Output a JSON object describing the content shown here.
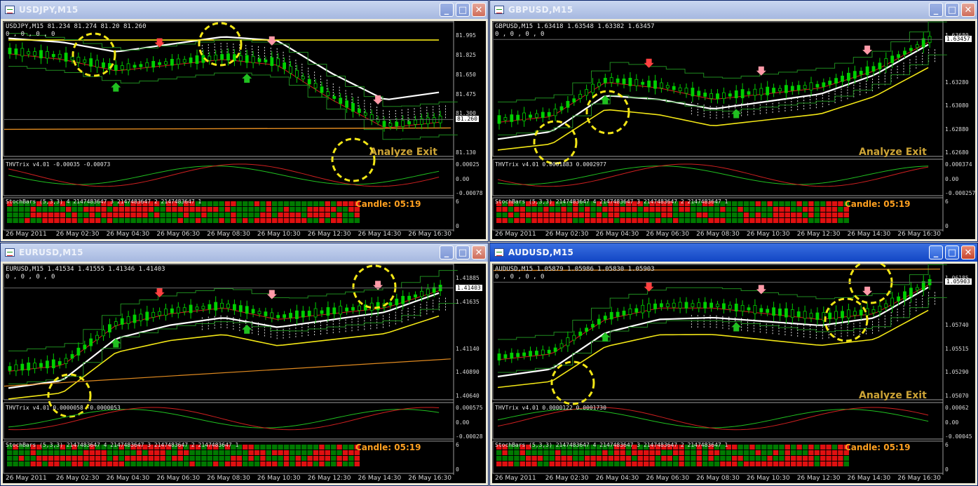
{
  "windows": [
    {
      "title": "USDJPY,M15",
      "active": false,
      "symbol_line": "USDJPY,M15  81.234 81.274 81.20 81.260",
      "zeros": "0 , 0 , 0 , 0",
      "price_labels": [
        "81.995",
        "81.825",
        "81.650",
        "81.475",
        "81.300",
        "81.260",
        "81.130"
      ],
      "current_price": "81.260",
      "trix_label": "THVTrix v4.01 -0.00035 -0.00073",
      "trix_labels": [
        "0.00025",
        "0.00",
        "-0.00078"
      ],
      "stoch_label": "StochBars (5,3,3) 4 2147483647 3 2147483647 2 2147483647 1",
      "stoch_labels": [
        "6",
        "0"
      ],
      "candle": "Candle:  05:19",
      "analyze": "Analyze Exit",
      "time_labels": [
        "26 May 2011",
        "26 May 02:30",
        "26 May 04:30",
        "26 May 06:30",
        "26 May 08:30",
        "26 May 10:30",
        "26 May 12:30",
        "26 May 14:30",
        "26 May 16:30"
      ]
    },
    {
      "title": "GBPUSD,M15",
      "active": false,
      "symbol_line": "GBPUSD,M15  1.63418 1.63548 1.63382 1.63457",
      "zeros": "0 , 0 , 0 , 0",
      "price_labels": [
        "1.63680",
        "1.63457",
        "1.63280",
        "1.63080",
        "1.62880",
        "1.62680"
      ],
      "current_price": "1.63457",
      "trix_label": "THVTrix v4.01 0.0001883 0.0002977",
      "trix_labels": [
        "0.000374",
        "0.00",
        "-0.000257"
      ],
      "stoch_label": "StochBars (5,3,3) 2147483647 4 2147483647 3 2147483647 2 2147483647 1",
      "stoch_labels": [
        "6",
        "0"
      ],
      "candle": "Candle:  05:19",
      "analyze": "Analyze Exit",
      "time_labels": [
        "26 May 2011",
        "26 May 02:30",
        "26 May 04:30",
        "26 May 06:30",
        "26 May 08:30",
        "26 May 10:30",
        "26 May 12:30",
        "26 May 14:30",
        "26 May 16:30"
      ]
    },
    {
      "title": "EURUSD,M15",
      "active": false,
      "symbol_line": "EURUSD,M15  1.41534 1.41555 1.41346 1.41403",
      "zeros": "0 , 0 , 0 , 0",
      "price_labels": [
        "1.41885",
        "1.41635",
        "1.41403",
        "1.41140",
        "1.40890",
        "1.40640"
      ],
      "current_price": "1.41403",
      "trix_label": "THVTrix v4.01 0.0000058 -0.0000053",
      "trix_labels": [
        "0.000575",
        "0.00",
        "-0.00028"
      ],
      "stoch_label": "StochBars (5,3,3) 2147483647 4 2147483647 3 2147483647 2 2147483647 1",
      "stoch_labels": [
        "6",
        "0"
      ],
      "candle": "Candle:  05:19",
      "analyze": "",
      "time_labels": [
        "26 May 2011",
        "26 May 02:30",
        "26 May 04:30",
        "26 May 06:30",
        "26 May 08:30",
        "26 May 10:30",
        "26 May 12:30",
        "26 May 14:30",
        "26 May 16:30"
      ]
    },
    {
      "title": "AUDUSD,M15",
      "active": true,
      "symbol_line": "AUDUSD,M15  1.05879 1.05986 1.05830 1.05903",
      "zeros": "0 , 0 , 0 , 0",
      "price_labels": [
        "1.06185",
        "1.05903",
        "1.05740",
        "1.05515",
        "1.05290",
        "1.05070"
      ],
      "current_price": "1.05903",
      "trix_label": "THVTrix v4.01 0.0000122 0.0001730",
      "trix_labels": [
        "0.00062",
        "0.00",
        "-0.00045"
      ],
      "stoch_label": "StochBars (5,3,3) 2147483647 4 2147483647 3 2147483647 2 2147483647 1",
      "stoch_labels": [
        "6",
        "0"
      ],
      "candle": "Candle:  05:19",
      "analyze": "Analyze Exit",
      "time_labels": [
        "26 May 2011",
        "26 May 02:30",
        "26 May 04:30",
        "26 May 06:30",
        "26 May 08:30",
        "26 May 10:30",
        "26 May 12:30",
        "26 May 14:30",
        "26 May 16:30"
      ]
    }
  ],
  "buttons": {
    "minimize": "_",
    "maximize": "□",
    "close": "✕"
  },
  "colors": {
    "bull": "#00c000",
    "bear": "#000000",
    "stoch_green": "#007a00",
    "stoch_red": "#e01010",
    "highlight": "#f2e616",
    "ichimoku": "#ffffff",
    "ma_yellow": "#f2e616",
    "ma_orange": "#e08a20"
  }
}
